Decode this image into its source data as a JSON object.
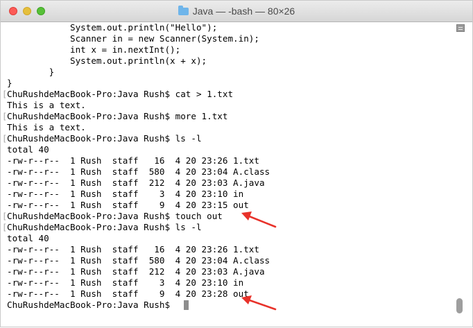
{
  "window": {
    "title": "Java — -bash — 80×26"
  },
  "terminal": {
    "lines": [
      "            System.out.println(\"Hello\");",
      "            Scanner in = new Scanner(System.in);",
      "            int x = in.nextInt();",
      "            System.out.println(x + x);",
      "        }",
      "}",
      "ChuRushdeMacBook-Pro:Java Rush$ cat > 1.txt",
      "This is a text.",
      "ChuRushdeMacBook-Pro:Java Rush$ more 1.txt",
      "This is a text.",
      "ChuRushdeMacBook-Pro:Java Rush$ ls -l",
      "total 40",
      "-rw-r--r--  1 Rush  staff   16  4 20 23:26 1.txt",
      "-rw-r--r--  1 Rush  staff  580  4 20 23:04 A.class",
      "-rw-r--r--  1 Rush  staff  212  4 20 23:03 A.java",
      "-rw-r--r--  1 Rush  staff    3  4 20 23:10 in",
      "-rw-r--r--  1 Rush  staff    9  4 20 23:15 out",
      "ChuRushdeMacBook-Pro:Java Rush$ touch out",
      "ChuRushdeMacBook-Pro:Java Rush$ ls -l",
      "total 40",
      "-rw-r--r--  1 Rush  staff   16  4 20 23:26 1.txt",
      "-rw-r--r--  1 Rush  staff  580  4 20 23:04 A.class",
      "-rw-r--r--  1 Rush  staff  212  4 20 23:03 A.java",
      "-rw-r--r--  1 Rush  staff    3  4 20 23:10 in",
      "-rw-r--r--  1 Rush  staff    9  4 20 23:28 out",
      "ChuRushdeMacBook-Pro:Java Rush$ "
    ],
    "mark_left": "[",
    "mark_right": "]"
  },
  "colors": {
    "annotation_arrow": "#e8322a",
    "close": "#fc5b57",
    "minimize": "#e5bf3c",
    "maximize": "#57c038"
  },
  "icons": [
    "folder-icon",
    "scrollbar-menu-icon",
    "annotation-arrow-icon"
  ]
}
